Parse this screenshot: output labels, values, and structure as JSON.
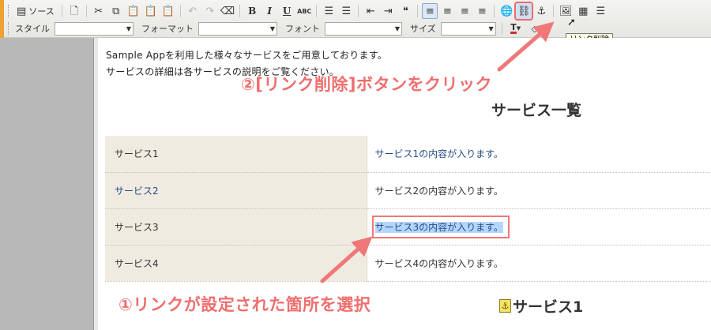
{
  "toolbar": {
    "row1": [
      {
        "name": "source-button",
        "label": "ソース",
        "icon": "source-icon",
        "glyph": "▤"
      },
      {
        "name": "new-page-button",
        "icon": "page-icon",
        "glyph": "🗋"
      },
      {
        "name": "cut-button",
        "icon": "scissors-icon",
        "glyph": "✂"
      },
      {
        "name": "copy-button",
        "icon": "copy-icon",
        "glyph": "⧉"
      },
      {
        "name": "paste-button",
        "icon": "clipboard-icon",
        "glyph": "📋"
      },
      {
        "name": "paste-text-button",
        "icon": "paste-text-icon",
        "glyph": "📋"
      },
      {
        "name": "paste-word-button",
        "icon": "paste-word-icon",
        "glyph": "📋"
      },
      {
        "name": "undo-button",
        "icon": "undo-icon",
        "glyph": "↶",
        "disabled": true
      },
      {
        "name": "redo-button",
        "icon": "redo-icon",
        "glyph": "↷",
        "disabled": true
      },
      {
        "name": "remove-format-button",
        "icon": "eraser-icon",
        "glyph": "⌫"
      },
      {
        "name": "bold-button",
        "label": "B",
        "style": "bold"
      },
      {
        "name": "italic-button",
        "label": "I",
        "style": "italic"
      },
      {
        "name": "underline-button",
        "label": "U",
        "style": "under"
      },
      {
        "name": "strikethrough-button",
        "label": "ABC",
        "style": "small"
      },
      {
        "name": "numbered-list-button",
        "icon": "numbered-list-icon",
        "glyph": "☰"
      },
      {
        "name": "bulleted-list-button",
        "icon": "bulleted-list-icon",
        "glyph": "☰"
      },
      {
        "name": "outdent-button",
        "icon": "outdent-icon",
        "glyph": "⇤"
      },
      {
        "name": "indent-button",
        "icon": "indent-icon",
        "glyph": "⇥"
      },
      {
        "name": "blockquote-button",
        "icon": "spellcheck-icon",
        "glyph": "❝"
      },
      {
        "name": "align-left-button",
        "icon": "align-left-icon",
        "glyph": "≡",
        "active": true
      },
      {
        "name": "align-center-button",
        "icon": "align-center-icon",
        "glyph": "≡"
      },
      {
        "name": "align-right-button",
        "icon": "align-right-icon",
        "glyph": "≡"
      },
      {
        "name": "align-justify-button",
        "icon": "align-justify-icon",
        "glyph": "≡"
      },
      {
        "name": "link-button",
        "icon": "link-globe-icon",
        "glyph": "🌐"
      },
      {
        "name": "unlink-button",
        "icon": "unlink-icon",
        "glyph": "⛓",
        "highlight": true
      },
      {
        "name": "anchor-button",
        "icon": "anchor-icon",
        "glyph": "⚓"
      },
      {
        "name": "image-button",
        "icon": "image-icon",
        "glyph": "🖼"
      },
      {
        "name": "table-button",
        "icon": "table-icon",
        "glyph": "▦"
      },
      {
        "name": "horizontal-rule-button",
        "icon": "horizontal-rule-icon",
        "glyph": "☰"
      }
    ],
    "row2": {
      "style_label": "スタイル",
      "format_label": "フォーマット",
      "font_label": "フォント",
      "size_label": "サイズ",
      "text_color_icon": "text-color-icon",
      "bg_color_icon": "bg-color-icon"
    },
    "tooltip": "リンク削除"
  },
  "editor": {
    "intro_line1": "Sample Appを利用した様々なサービスをご用意しております。",
    "intro_line2": "サービスの詳細は各サービスの説明をご覧ください。",
    "heading": "サービス一覧",
    "services": [
      {
        "name": "サービス1",
        "desc": "サービス1の内容が入ります。",
        "name_link": false,
        "desc_link": true
      },
      {
        "name": "サービス2",
        "desc": "サービス2の内容が入ります。",
        "name_link": true,
        "desc_link": false
      },
      {
        "name": "サービス3",
        "desc": "サービス3の内容が入ります。",
        "name_link": false,
        "desc_link": true,
        "selected": true
      },
      {
        "name": "サービス4",
        "desc": "サービス4の内容が入ります。",
        "name_link": false,
        "desc_link": false
      }
    ],
    "subheading": "サービス1"
  },
  "annotations": {
    "step1": "①リンクが設定された箇所を選択",
    "step2": "②[リンク削除]ボタンをクリック"
  },
  "colors": {
    "annotation": "#f06e6e",
    "link": "#264d86",
    "selection": "#b5d5ff",
    "table_name_bg": "#f0ebe1"
  }
}
